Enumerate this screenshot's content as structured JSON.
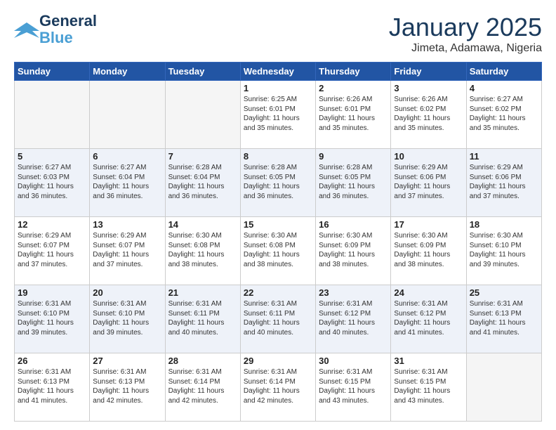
{
  "header": {
    "logo_line1": "General",
    "logo_line2": "Blue",
    "month_title": "January 2025",
    "location": "Jimeta, Adamawa, Nigeria"
  },
  "weekdays": [
    "Sunday",
    "Monday",
    "Tuesday",
    "Wednesday",
    "Thursday",
    "Friday",
    "Saturday"
  ],
  "weeks": [
    [
      {
        "day": "",
        "info": ""
      },
      {
        "day": "",
        "info": ""
      },
      {
        "day": "",
        "info": ""
      },
      {
        "day": "1",
        "info": "Sunrise: 6:25 AM\nSunset: 6:01 PM\nDaylight: 11 hours\nand 35 minutes."
      },
      {
        "day": "2",
        "info": "Sunrise: 6:26 AM\nSunset: 6:01 PM\nDaylight: 11 hours\nand 35 minutes."
      },
      {
        "day": "3",
        "info": "Sunrise: 6:26 AM\nSunset: 6:02 PM\nDaylight: 11 hours\nand 35 minutes."
      },
      {
        "day": "4",
        "info": "Sunrise: 6:27 AM\nSunset: 6:02 PM\nDaylight: 11 hours\nand 35 minutes."
      }
    ],
    [
      {
        "day": "5",
        "info": "Sunrise: 6:27 AM\nSunset: 6:03 PM\nDaylight: 11 hours\nand 36 minutes."
      },
      {
        "day": "6",
        "info": "Sunrise: 6:27 AM\nSunset: 6:04 PM\nDaylight: 11 hours\nand 36 minutes."
      },
      {
        "day": "7",
        "info": "Sunrise: 6:28 AM\nSunset: 6:04 PM\nDaylight: 11 hours\nand 36 minutes."
      },
      {
        "day": "8",
        "info": "Sunrise: 6:28 AM\nSunset: 6:05 PM\nDaylight: 11 hours\nand 36 minutes."
      },
      {
        "day": "9",
        "info": "Sunrise: 6:28 AM\nSunset: 6:05 PM\nDaylight: 11 hours\nand 36 minutes."
      },
      {
        "day": "10",
        "info": "Sunrise: 6:29 AM\nSunset: 6:06 PM\nDaylight: 11 hours\nand 37 minutes."
      },
      {
        "day": "11",
        "info": "Sunrise: 6:29 AM\nSunset: 6:06 PM\nDaylight: 11 hours\nand 37 minutes."
      }
    ],
    [
      {
        "day": "12",
        "info": "Sunrise: 6:29 AM\nSunset: 6:07 PM\nDaylight: 11 hours\nand 37 minutes."
      },
      {
        "day": "13",
        "info": "Sunrise: 6:29 AM\nSunset: 6:07 PM\nDaylight: 11 hours\nand 37 minutes."
      },
      {
        "day": "14",
        "info": "Sunrise: 6:30 AM\nSunset: 6:08 PM\nDaylight: 11 hours\nand 38 minutes."
      },
      {
        "day": "15",
        "info": "Sunrise: 6:30 AM\nSunset: 6:08 PM\nDaylight: 11 hours\nand 38 minutes."
      },
      {
        "day": "16",
        "info": "Sunrise: 6:30 AM\nSunset: 6:09 PM\nDaylight: 11 hours\nand 38 minutes."
      },
      {
        "day": "17",
        "info": "Sunrise: 6:30 AM\nSunset: 6:09 PM\nDaylight: 11 hours\nand 38 minutes."
      },
      {
        "day": "18",
        "info": "Sunrise: 6:30 AM\nSunset: 6:10 PM\nDaylight: 11 hours\nand 39 minutes."
      }
    ],
    [
      {
        "day": "19",
        "info": "Sunrise: 6:31 AM\nSunset: 6:10 PM\nDaylight: 11 hours\nand 39 minutes."
      },
      {
        "day": "20",
        "info": "Sunrise: 6:31 AM\nSunset: 6:10 PM\nDaylight: 11 hours\nand 39 minutes."
      },
      {
        "day": "21",
        "info": "Sunrise: 6:31 AM\nSunset: 6:11 PM\nDaylight: 11 hours\nand 40 minutes."
      },
      {
        "day": "22",
        "info": "Sunrise: 6:31 AM\nSunset: 6:11 PM\nDaylight: 11 hours\nand 40 minutes."
      },
      {
        "day": "23",
        "info": "Sunrise: 6:31 AM\nSunset: 6:12 PM\nDaylight: 11 hours\nand 40 minutes."
      },
      {
        "day": "24",
        "info": "Sunrise: 6:31 AM\nSunset: 6:12 PM\nDaylight: 11 hours\nand 41 minutes."
      },
      {
        "day": "25",
        "info": "Sunrise: 6:31 AM\nSunset: 6:13 PM\nDaylight: 11 hours\nand 41 minutes."
      }
    ],
    [
      {
        "day": "26",
        "info": "Sunrise: 6:31 AM\nSunset: 6:13 PM\nDaylight: 11 hours\nand 41 minutes."
      },
      {
        "day": "27",
        "info": "Sunrise: 6:31 AM\nSunset: 6:13 PM\nDaylight: 11 hours\nand 42 minutes."
      },
      {
        "day": "28",
        "info": "Sunrise: 6:31 AM\nSunset: 6:14 PM\nDaylight: 11 hours\nand 42 minutes."
      },
      {
        "day": "29",
        "info": "Sunrise: 6:31 AM\nSunset: 6:14 PM\nDaylight: 11 hours\nand 42 minutes."
      },
      {
        "day": "30",
        "info": "Sunrise: 6:31 AM\nSunset: 6:15 PM\nDaylight: 11 hours\nand 43 minutes."
      },
      {
        "day": "31",
        "info": "Sunrise: 6:31 AM\nSunset: 6:15 PM\nDaylight: 11 hours\nand 43 minutes."
      },
      {
        "day": "",
        "info": ""
      }
    ]
  ]
}
